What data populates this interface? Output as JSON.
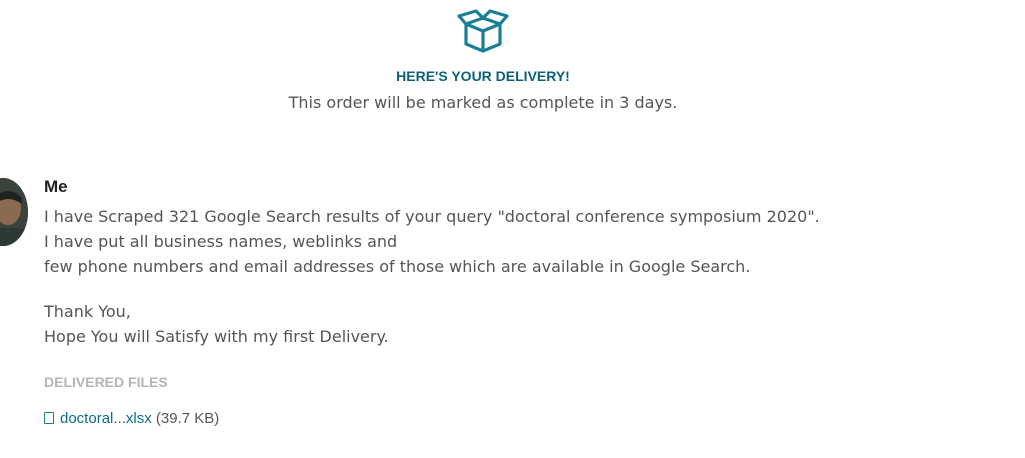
{
  "header": {
    "icon": "open-box-icon",
    "title": "HERE'S YOUR DELIVERY!",
    "subtitle": "This order will be marked as complete in 3 days."
  },
  "message": {
    "sender": "Me",
    "lines": [
      "I have Scraped 321 Google Search results of your query \"doctoral conference symposium 2020\".",
      "I have put all business names, weblinks and",
      "few phone numbers and email addresses of those which are available in Google Search.",
      "",
      "Thank You,",
      "Hope You will Satisfy with my first Delivery."
    ]
  },
  "files": {
    "heading": "DELIVERED FILES",
    "items": [
      {
        "icon": "file-icon",
        "name": "doctoral...xlsx",
        "size": "(39.7 KB)"
      }
    ]
  },
  "colors": {
    "accent": "#0d5f78",
    "icon": "#1a7f96",
    "text": "#555555",
    "muted": "#b5b5b5"
  }
}
